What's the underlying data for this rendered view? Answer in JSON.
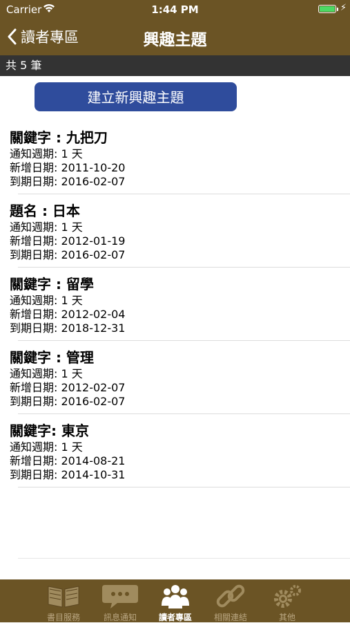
{
  "status": {
    "carrier": "Carrier",
    "time": "1:44 PM"
  },
  "nav": {
    "back_label": "讀者專區",
    "title": "興趣主題"
  },
  "count_text": "共 5 筆",
  "create_button": "建立新興趣主題",
  "items": [
    {
      "heading": "關鍵字 : 九把刀",
      "period": "通知週期:  1 天",
      "added": "新增日期:  2011-10-20",
      "expires": "到期日期:  2016-02-07"
    },
    {
      "heading": "題名 : 日本",
      "period": "通知週期:  1 天",
      "added": "新增日期:  2012-01-19",
      "expires": "到期日期:  2016-02-07"
    },
    {
      "heading": "關鍵字 : 留學",
      "period": "通知週期:  1 天",
      "added": "新增日期:  2012-02-04",
      "expires": "到期日期:  2018-12-31"
    },
    {
      "heading": "關鍵字 : 管理",
      "period": "通知週期:  1 天",
      "added": "新增日期:  2012-02-07",
      "expires": "到期日期:  2016-02-07"
    },
    {
      "heading": "關鍵字:  東京",
      "period": "通知週期:  1 天",
      "added": "新增日期:  2014-08-21",
      "expires": "到期日期:  2014-10-31"
    }
  ],
  "tabs": [
    {
      "label": "書目服務",
      "icon": "book-icon",
      "active": false
    },
    {
      "label": "訊息通知",
      "icon": "chat-bubble-icon",
      "active": false
    },
    {
      "label": "讀者專區",
      "icon": "people-icon",
      "active": true
    },
    {
      "label": "相關連結",
      "icon": "link-icon",
      "active": false
    },
    {
      "label": "其他",
      "icon": "gear-icon",
      "active": false
    }
  ],
  "colors": {
    "brown": "#6b5425",
    "dark_bar": "#333333",
    "button_blue": "#2f4c9c",
    "tab_inactive": "#b9a681"
  }
}
